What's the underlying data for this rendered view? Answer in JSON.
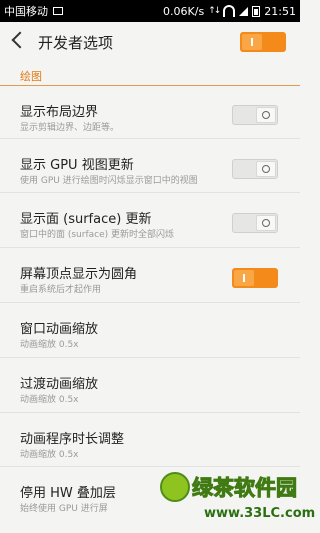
{
  "status_bar": {
    "carrier": "中国移动",
    "speed": "0.06K/s",
    "time": "21:51"
  },
  "header": {
    "title": "开发者选项",
    "master_toggle_on": true
  },
  "section": {
    "title": "绘图"
  },
  "settings": [
    {
      "title": "显示布局边界",
      "subtitle": "显示剪辑边界、边距等。",
      "toggle": "off"
    },
    {
      "title": "显示 GPU 视图更新",
      "subtitle": "使用 GPU 进行绘图时闪烁显示窗口中的视图",
      "toggle": "off"
    },
    {
      "title": "显示面 (surface) 更新",
      "subtitle": "窗口中的面 (surface) 更新时全部闪烁",
      "toggle": "off"
    },
    {
      "title": "屏幕顶点显示为圆角",
      "subtitle": "重启系统后才起作用",
      "toggle": "on"
    },
    {
      "title": "窗口动画缩放",
      "subtitle": "动画缩放 0.5x",
      "toggle": "none"
    },
    {
      "title": "过渡动画缩放",
      "subtitle": "动画缩放 0.5x",
      "toggle": "none"
    },
    {
      "title": "动画程序时长调整",
      "subtitle": "动画缩放 0.5x",
      "toggle": "none"
    },
    {
      "title": "停用 HW 叠加层",
      "subtitle": "始终使用 GPU 进行屏",
      "toggle": "none"
    }
  ],
  "watermark": {
    "brand": "绿茶软件园",
    "url": "www.33LC.com"
  }
}
